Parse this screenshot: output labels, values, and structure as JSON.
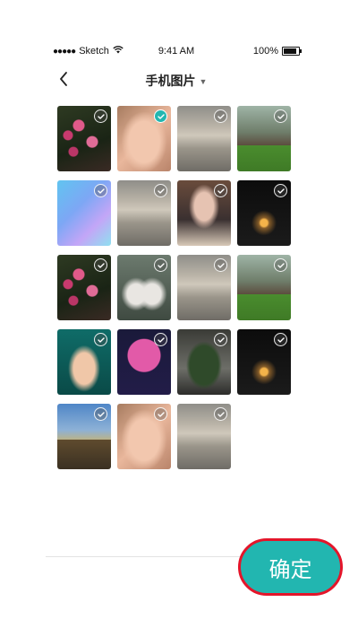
{
  "status_bar": {
    "signal_dots": "●●●●●",
    "carrier": "Sketch",
    "wifi_icon": "wifi-icon",
    "time": "9:41 AM",
    "battery_percent": "100%",
    "battery_icon": "battery-icon"
  },
  "header": {
    "back_icon": "chevron-left-icon",
    "title": "手机图片",
    "title_caret": "▼"
  },
  "photos": [
    {
      "name": "photo-roses",
      "selected": false
    },
    {
      "name": "photo-face",
      "selected": true
    },
    {
      "name": "photo-clouds",
      "selected": false
    },
    {
      "name": "photo-house",
      "selected": false
    },
    {
      "name": "photo-abstract",
      "selected": false
    },
    {
      "name": "photo-clouds",
      "selected": false
    },
    {
      "name": "photo-girl-poster",
      "selected": false
    },
    {
      "name": "photo-dark-light",
      "selected": false
    },
    {
      "name": "photo-roses",
      "selected": false
    },
    {
      "name": "photo-twins",
      "selected": false
    },
    {
      "name": "photo-clouds",
      "selected": false
    },
    {
      "name": "photo-house",
      "selected": false
    },
    {
      "name": "photo-deer-girl",
      "selected": false
    },
    {
      "name": "photo-poster",
      "selected": false
    },
    {
      "name": "photo-island",
      "selected": false
    },
    {
      "name": "photo-dark-light",
      "selected": false
    },
    {
      "name": "photo-castle",
      "selected": false
    },
    {
      "name": "photo-face",
      "selected": false
    },
    {
      "name": "photo-clouds",
      "selected": false
    }
  ],
  "confirm_button": {
    "label": "确定"
  },
  "colors": {
    "accent": "#22b6b0",
    "highlight_border": "#e4152a"
  }
}
